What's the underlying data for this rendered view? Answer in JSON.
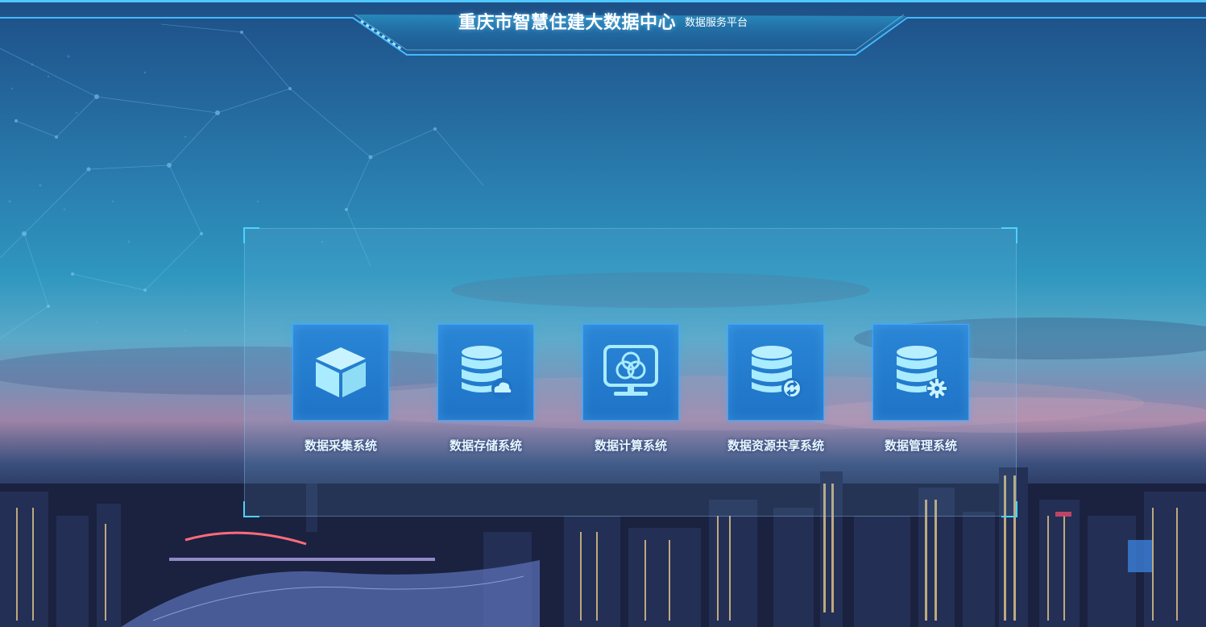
{
  "header": {
    "title": "重庆市智慧住建大数据中心",
    "subtitle": "数据服务平台"
  },
  "systems": [
    {
      "label": "数据采集系统",
      "icon": "cube-icon"
    },
    {
      "label": "数据存储系统",
      "icon": "database-cloud-icon"
    },
    {
      "label": "数据计算系统",
      "icon": "monitor-circles-icon"
    },
    {
      "label": "数据资源共享系统",
      "icon": "database-sync-icon"
    },
    {
      "label": "数据管理系统",
      "icon": "database-gear-icon"
    }
  ],
  "colors": {
    "accent": "#4fd2ff",
    "tile_bg": "#2080cf",
    "icon_fill": "#a9ecff"
  }
}
